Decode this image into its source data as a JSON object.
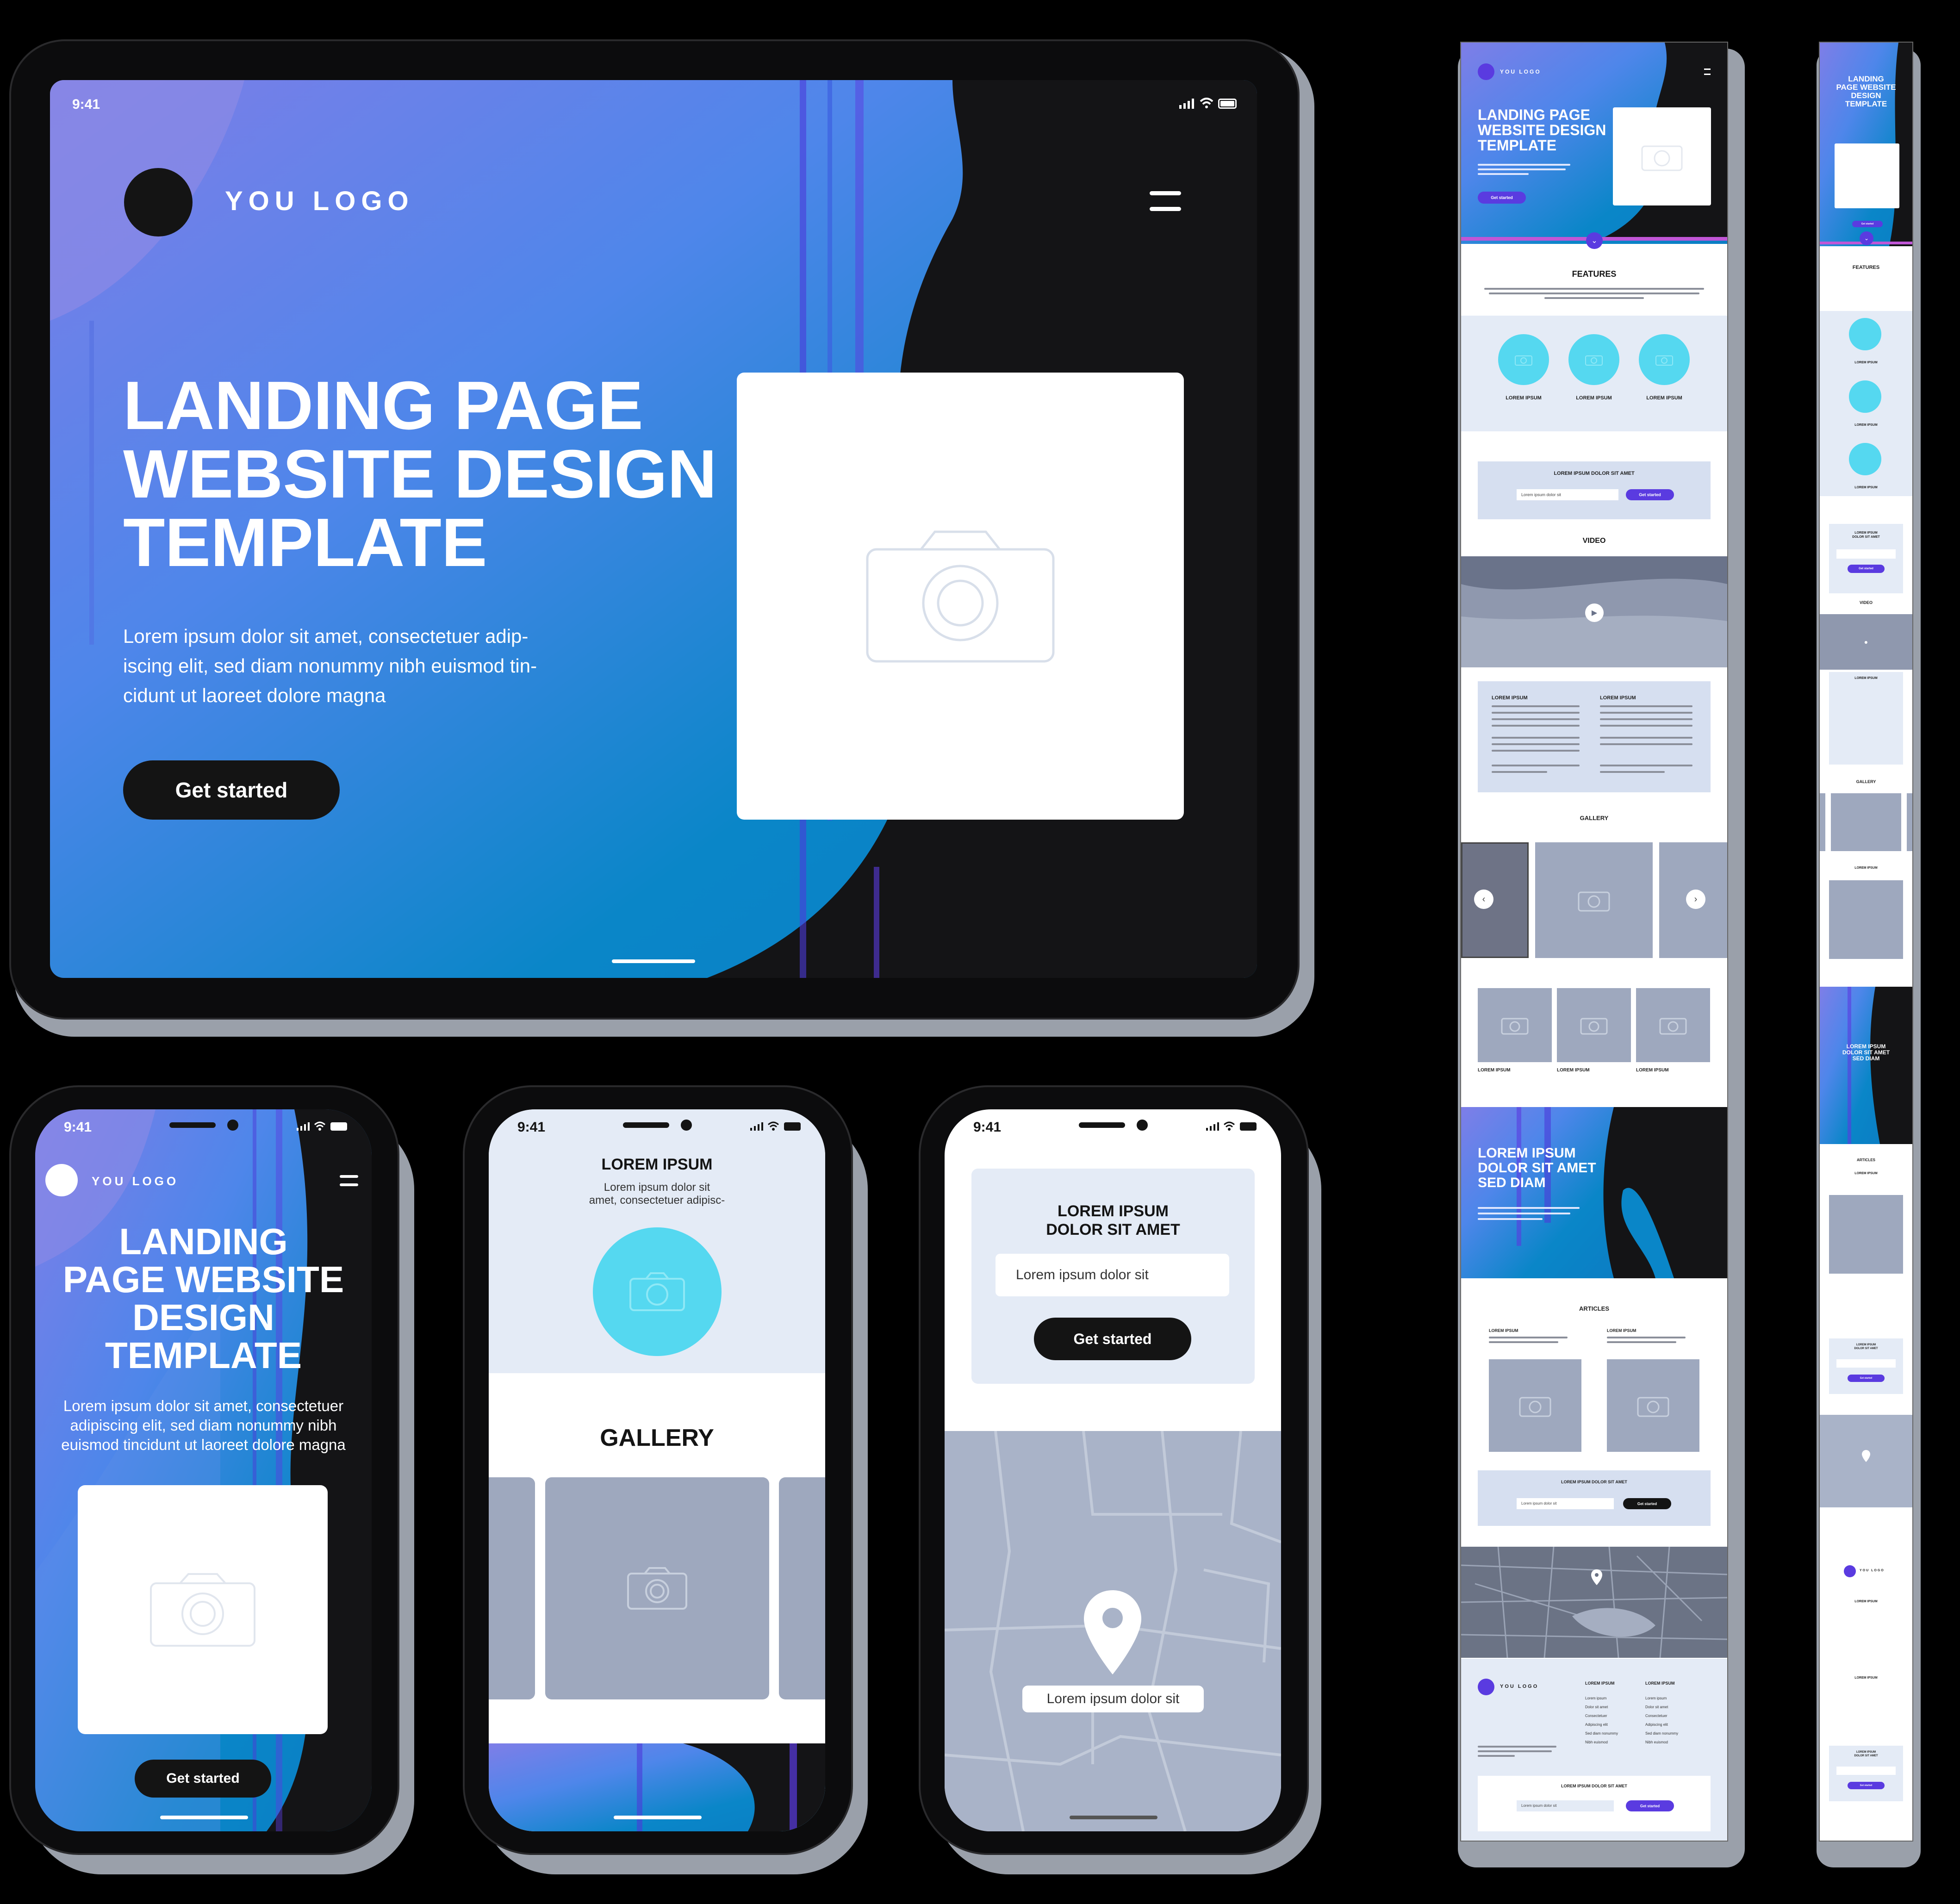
{
  "colors": {
    "background": "#000000",
    "accent_blue": "#0a86c8",
    "accent_purple": "#5a3be0",
    "cyan": "#55d8f0",
    "light_panel": "#e4ebf6",
    "grey_photo": "#9ea8be",
    "dark": "#141414"
  },
  "tablet": {
    "status_time": "9:41",
    "logo_text": "YOU LOGO",
    "menu_icon": "hamburger-icon",
    "headline": "LANDING PAGE WEBSITE DESIGN TEMPLATE",
    "headline_lines": [
      "LANDING PAGE",
      "WEBSITE DESIGN",
      "TEMPLATE"
    ],
    "body_lines": [
      "Lorem ipsum dolor sit amet, consectetuer adip-",
      "iscing elit, sed diam nonummy nibh euismod tin-",
      "cidunt ut laoreet dolore magna"
    ],
    "cta_label": "Get started",
    "image_icon": "camera-icon"
  },
  "phone1": {
    "status_time": "9:41",
    "logo_text": "YOU LOGO",
    "headline_lines": [
      "LANDING",
      "PAGE WEBSITE",
      "DESIGN",
      "TEMPLATE"
    ],
    "body_lines": [
      "Lorem ipsum dolor sit amet, consectetuer",
      "adipiscing elit, sed diam nonummy nibh",
      "euismod tincidunt ut laoreet dolore magna"
    ],
    "cta_label": "Get started"
  },
  "phone2": {
    "status_time": "9:41",
    "title": "LOREM IPSUM",
    "subtitle_lines": [
      "Lorem ipsum dolor sit",
      "amet, consectetuer adipisc-"
    ],
    "gallery_title": "GALLERY"
  },
  "phone3": {
    "status_time": "9:41",
    "form_title_lines": [
      "LOREM IPSUM",
      "DOLOR SIT AMET"
    ],
    "input_placeholder": "Lorem ipsum dolor sit",
    "cta_label": "Get started",
    "map_label": "Lorem ipsum dolor sit"
  },
  "desktop_page": {
    "logo_text": "YOU LOGO",
    "hero_lines": [
      "LANDING PAGE",
      "WEBSITE DESIGN",
      "TEMPLATE"
    ],
    "hero_cta": "Get started",
    "features_title": "FEATURES",
    "feature_labels": [
      "LOREM IPSUM",
      "LOREM IPSUM",
      "LOREM IPSUM"
    ],
    "form_title": "LOREM IPSUM DOLOR SIT AMET",
    "form_input": "Lorem ipsum dolor sit",
    "form_cta": "Get started",
    "video_title": "VIDEO",
    "text_cols": [
      "LOREM IPSUM",
      "LOREM IPSUM"
    ],
    "gallery_title": "GALLERY",
    "thumb_labels": [
      "LOREM IPSUM",
      "LOREM IPSUM",
      "LOREM IPSUM"
    ],
    "promo_lines": [
      "LOREM IPSUM",
      "DOLOR SIT AMET",
      "SED DIAM"
    ],
    "articles_title": "ARTICLES",
    "article_titles": [
      "LOREM IPSUM",
      "LOREM IPSUM"
    ],
    "form2_title": "LOREM IPSUM DOLOR SIT AMET",
    "form2_input": "Lorem ipsum dolor sit",
    "form2_cta": "Get started",
    "footer_logo": "YOU LOGO",
    "footer_col_titles": [
      "LOREM IPSUM",
      "LOREM IPSUM"
    ],
    "footer_col1": [
      "Lorem ipsum",
      "Dolor sit amet",
      "Consectetuer",
      "Adipiscing elit",
      "Sed diam nonummy",
      "Nibh euismod"
    ],
    "footer_col2": [
      "Lorem ipsum",
      "Dolor sit amet",
      "Consectetuer",
      "Adipiscing elit",
      "Sed diam nonummy",
      "Nibh euismod"
    ],
    "footer_form_title": "LOREM IPSUM DOLOR SIT AMET",
    "footer_form_input": "Lorem ipsum dolor sit",
    "footer_form_cta": "Get started"
  },
  "mobile_page": {
    "hero_lines": [
      "LANDING",
      "PAGE WEBSITE",
      "DESIGN",
      "TEMPLATE"
    ],
    "hero_cta": "Get started",
    "features_title": "FEATURES",
    "feature_labels": [
      "LOREM IPSUM",
      "LOREM IPSUM",
      "LOREM IPSUM"
    ],
    "form_title_lines": [
      "LOREM IPSUM",
      "DOLOR SIT AMET"
    ],
    "form_cta": "Get started",
    "video_title": "VIDEO",
    "text_title": "LOREM IPSUM",
    "gallery_title": "GALLERY",
    "gallery_label": "LOREM IPSUM",
    "promo_lines": [
      "LOREM IPSUM",
      "DOLOR SIT AMET",
      "SED DIAM"
    ],
    "articles_title": "ARTICLES",
    "article_title": "LOREM IPSUM",
    "form2_title_lines": [
      "LOREM IPSUM",
      "DOLOR SIT AMET"
    ],
    "form2_cta": "Get started",
    "footer_logo": "YOU LOGO",
    "footer_col_titles": [
      "LOREM IPSUM",
      "LOREM IPSUM"
    ],
    "footer_form_title_lines": [
      "LOREM IPSUM",
      "DOLOR SIT AMET"
    ],
    "footer_form_cta": "Get started"
  }
}
